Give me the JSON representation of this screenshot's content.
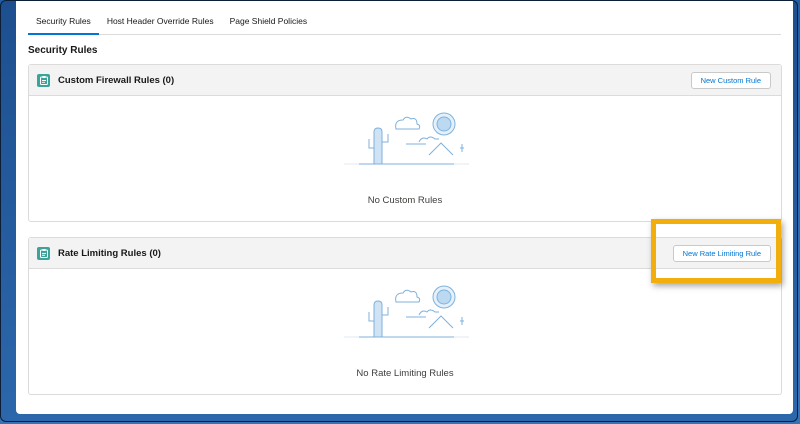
{
  "tabs": [
    {
      "label": "Security Rules",
      "active": true
    },
    {
      "label": "Host Header Override Rules",
      "active": false
    },
    {
      "label": "Page Shield Policies",
      "active": false
    }
  ],
  "section_title": "Security Rules",
  "cards": [
    {
      "title": "Custom Firewall Rules (0)",
      "button_label": "New Custom Rule",
      "empty_text": "No Custom Rules",
      "icon": "clipboard-icon"
    },
    {
      "title": "Rate Limiting Rules (0)",
      "button_label": "New Rate Limiting Rule",
      "empty_text": "No Rate Limiting Rules",
      "icon": "clipboard-icon"
    }
  ],
  "colors": {
    "accent": "#0176d3",
    "icon_bg": "#3ba39a",
    "highlight": "#f2ae0c",
    "illustration": "#7fb2dc"
  }
}
